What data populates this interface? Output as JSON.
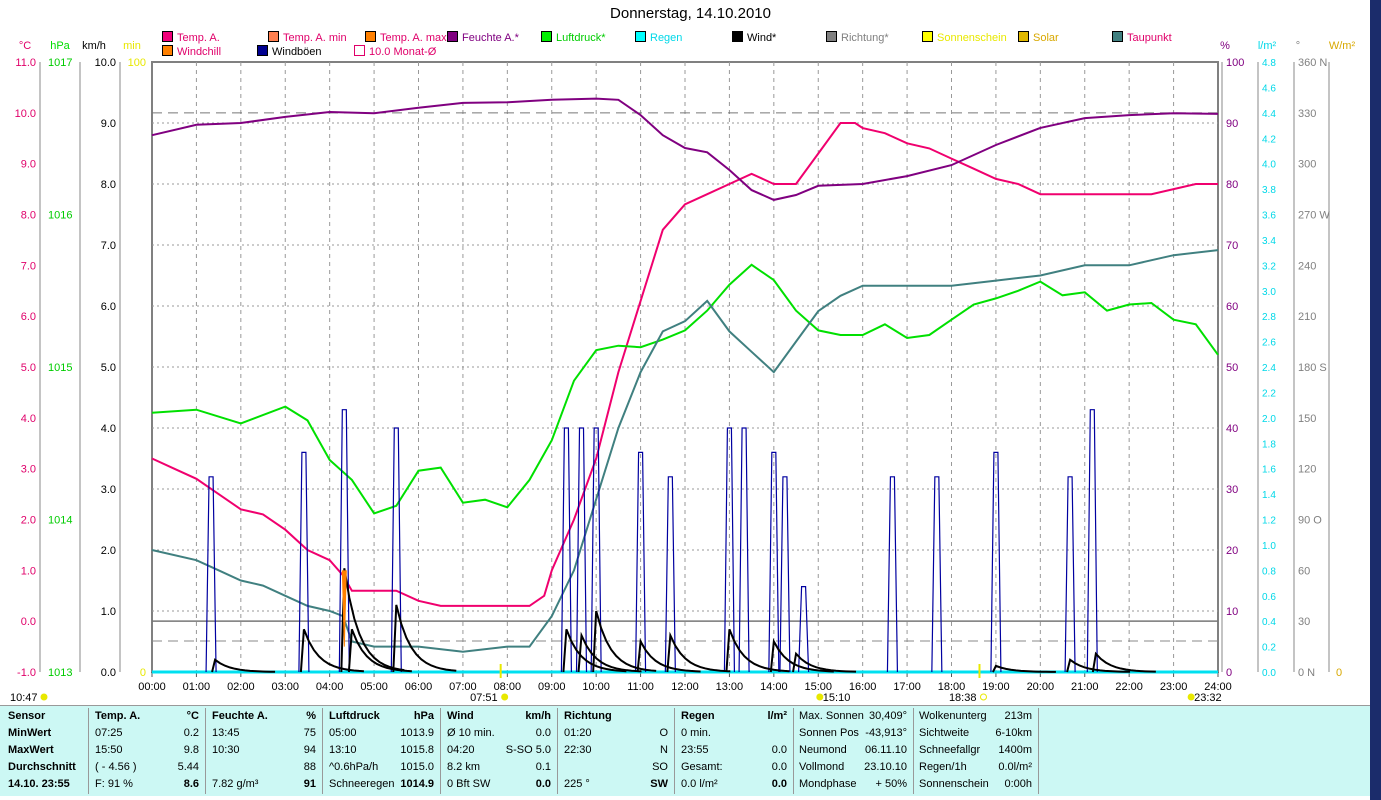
{
  "chart_data": {
    "type": "line",
    "title": "Donnerstag, 14.10.2010",
    "x_axis": {
      "min": 0,
      "max": 24,
      "unit": "hour",
      "tick_labels": [
        "00:00",
        "01:00",
        "02:00",
        "03:00",
        "04:00",
        "05:00",
        "06:00",
        "07:00",
        "08:00",
        "09:00",
        "10:00",
        "11:00",
        "12:00",
        "13:00",
        "14:00",
        "15:00",
        "16:00",
        "17:00",
        "18:00",
        "19:00",
        "20:00",
        "21:00",
        "22:00",
        "23:00",
        "24:00"
      ]
    },
    "axes": {
      "temp": {
        "unit": "°C",
        "min": -1,
        "max": 11,
        "step": 1,
        "color": "#e0006a"
      },
      "pressure": {
        "unit": "hPa",
        "min": 1013,
        "max": 1017,
        "step": 1,
        "color": "#00dd00"
      },
      "wind": {
        "unit": "km/h",
        "min": 0,
        "max": 10,
        "step": 1,
        "color": "#000000"
      },
      "sun": {
        "unit": "min",
        "min": 0,
        "max": 100,
        "color": "#e8e800"
      },
      "humidity": {
        "unit": "%",
        "min": 0,
        "max": 100,
        "step": 10,
        "color": "#800080"
      },
      "rain": {
        "unit": "l/m²",
        "min": 0,
        "max": 4.8,
        "step": 0.2,
        "color": "#00d8e8"
      },
      "direction": {
        "unit": "°",
        "min": 0,
        "max": 360,
        "step": 30,
        "color": "#808080",
        "compass": {
          "0": "N",
          "90": "O",
          "180": "S",
          "270": "W",
          "360": "N"
        }
      },
      "solar": {
        "unit": "W/m²",
        "min": 0,
        "color": "#d8a800"
      }
    },
    "legend": [
      {
        "label": "Temp. A.",
        "color": "#f0007a",
        "text_color": "#e0006a"
      },
      {
        "label": "Temp. A. min",
        "color": "#ff8050",
        "text_color": "#e0006a"
      },
      {
        "label": "Temp. A. max",
        "color": "#ff8000",
        "text_color": "#e0006a"
      },
      {
        "label": "Feuchte A.*",
        "color": "#800080",
        "text_color": "#800080"
      },
      {
        "label": "Luftdruck*",
        "color": "#00ee00",
        "text_color": "#00cc00"
      },
      {
        "label": "Regen",
        "color": "#00ffff",
        "text_color": "#00d8e8"
      },
      {
        "label": "Wind*",
        "color": "#000000",
        "text_color": "#000000"
      },
      {
        "label": "Richtung*",
        "color": "#808080",
        "text_color": "#808080"
      },
      {
        "label": "Sonnenschein",
        "color": "#ffff00",
        "text_color": "#e8e800"
      },
      {
        "label": "Solar",
        "color": "#e0b800",
        "text_color": "#d8a800"
      },
      {
        "label": "Taupunkt",
        "color": "#408080",
        "text_color": "#e0006a"
      },
      {
        "label": "Windchill",
        "color": "#ff8000",
        "text_color": "#e0006a"
      },
      {
        "label": "Windböen",
        "color": "#000090",
        "text_color": "#000000"
      },
      {
        "label": "10.0 Monat-Ø",
        "color": "#ffffff",
        "text_color": "#e0006a"
      }
    ],
    "reference_lines": {
      "monthly_avg_temp": 10.0,
      "freezing_temp": 0.0
    },
    "series": [
      {
        "name": "Temp. A.",
        "axis": "temp",
        "color": "#f0006e",
        "points": [
          [
            0,
            3.2
          ],
          [
            0.5,
            3.0
          ],
          [
            1,
            2.8
          ],
          [
            1.5,
            2.5
          ],
          [
            2,
            2.2
          ],
          [
            2.5,
            2.1
          ],
          [
            3,
            1.8
          ],
          [
            3.5,
            1.4
          ],
          [
            4,
            1.2
          ],
          [
            4.3,
            0.9
          ],
          [
            4.5,
            0.6
          ],
          [
            5,
            0.6
          ],
          [
            5.5,
            0.6
          ],
          [
            6,
            0.4
          ],
          [
            6.5,
            0.3
          ],
          [
            7,
            0.3
          ],
          [
            7.5,
            0.3
          ],
          [
            8,
            0.3
          ],
          [
            8.5,
            0.3
          ],
          [
            8.83,
            0.5
          ],
          [
            9,
            1.0
          ],
          [
            9.5,
            2.0
          ],
          [
            10,
            3.2
          ],
          [
            10.5,
            4.9
          ],
          [
            11,
            6.3
          ],
          [
            11.5,
            7.7
          ],
          [
            12,
            8.2
          ],
          [
            12.5,
            8.4
          ],
          [
            13,
            8.6
          ],
          [
            13.5,
            8.8
          ],
          [
            14,
            8.6
          ],
          [
            14.5,
            8.6
          ],
          [
            15,
            9.2
          ],
          [
            15.5,
            9.8
          ],
          [
            15.83,
            9.8
          ],
          [
            16,
            9.7
          ],
          [
            16.5,
            9.6
          ],
          [
            17,
            9.4
          ],
          [
            17.5,
            9.3
          ],
          [
            18,
            9.1
          ],
          [
            18.5,
            8.9
          ],
          [
            19,
            8.7
          ],
          [
            19.5,
            8.6
          ],
          [
            20,
            8.4
          ],
          [
            20.5,
            8.4
          ],
          [
            21,
            8.4
          ],
          [
            21.5,
            8.4
          ],
          [
            22,
            8.4
          ],
          [
            22.5,
            8.4
          ],
          [
            23,
            8.5
          ],
          [
            23.5,
            8.6
          ],
          [
            24,
            8.6
          ]
        ]
      },
      {
        "name": "Feuchte A.*",
        "axis": "humidity",
        "color": "#800080",
        "points": [
          [
            0,
            88
          ],
          [
            1,
            89.7
          ],
          [
            2,
            90
          ],
          [
            3,
            91
          ],
          [
            4,
            91.8
          ],
          [
            5,
            91.6
          ],
          [
            6,
            92.5
          ],
          [
            7,
            93.3
          ],
          [
            8,
            93.4
          ],
          [
            9,
            93.8
          ],
          [
            10,
            94
          ],
          [
            10.5,
            93.8
          ],
          [
            11,
            91.3
          ],
          [
            11.5,
            88
          ],
          [
            12,
            85.9
          ],
          [
            12.5,
            85.2
          ],
          [
            13,
            82.3
          ],
          [
            13.5,
            79
          ],
          [
            14,
            77.4
          ],
          [
            14.5,
            78.2
          ],
          [
            15,
            79.7
          ],
          [
            16,
            80
          ],
          [
            17,
            81.3
          ],
          [
            18,
            83.1
          ],
          [
            19,
            86.4
          ],
          [
            20,
            89.2
          ],
          [
            21,
            90.8
          ],
          [
            22,
            91.3
          ],
          [
            23,
            91.6
          ],
          [
            24,
            91.5
          ]
        ]
      },
      {
        "name": "Luftdruck*",
        "axis": "pressure",
        "color": "#00e000",
        "points": [
          [
            0,
            1014.7
          ],
          [
            1,
            1014.72
          ],
          [
            2,
            1014.63
          ],
          [
            3,
            1014.74
          ],
          [
            3.5,
            1014.65
          ],
          [
            4,
            1014.39
          ],
          [
            4.5,
            1014.26
          ],
          [
            5,
            1014.04
          ],
          [
            5.5,
            1014.09
          ],
          [
            6,
            1014.32
          ],
          [
            6.5,
            1014.34
          ],
          [
            7,
            1014.11
          ],
          [
            7.5,
            1014.13
          ],
          [
            8,
            1014.08
          ],
          [
            8.5,
            1014.26
          ],
          [
            9,
            1014.52
          ],
          [
            9.5,
            1014.91
          ],
          [
            10,
            1015.11
          ],
          [
            10.5,
            1015.14
          ],
          [
            11,
            1015.13
          ],
          [
            11.5,
            1015.18
          ],
          [
            12,
            1015.24
          ],
          [
            12.5,
            1015.37
          ],
          [
            13,
            1015.54
          ],
          [
            13.5,
            1015.67
          ],
          [
            14,
            1015.57
          ],
          [
            14.5,
            1015.37
          ],
          [
            15,
            1015.24
          ],
          [
            15.5,
            1015.21
          ],
          [
            16,
            1015.21
          ],
          [
            16.5,
            1015.28
          ],
          [
            17,
            1015.19
          ],
          [
            17.5,
            1015.21
          ],
          [
            18,
            1015.31
          ],
          [
            18.5,
            1015.41
          ],
          [
            19,
            1015.45
          ],
          [
            19.5,
            1015.5
          ],
          [
            20,
            1015.56
          ],
          [
            20.5,
            1015.47
          ],
          [
            21,
            1015.49
          ],
          [
            21.5,
            1015.37
          ],
          [
            22,
            1015.41
          ],
          [
            22.5,
            1015.42
          ],
          [
            23,
            1015.31
          ],
          [
            23.5,
            1015.28
          ],
          [
            24,
            1015.08
          ]
        ]
      },
      {
        "name": "Taupunkt",
        "axis": "temp",
        "color": "#408080",
        "points": [
          [
            0,
            1.4
          ],
          [
            1,
            1.2
          ],
          [
            1.5,
            1.0
          ],
          [
            2,
            0.8
          ],
          [
            2.5,
            0.7
          ],
          [
            3,
            0.5
          ],
          [
            3.5,
            0.3
          ],
          [
            4,
            0.2
          ],
          [
            4.3,
            0.1
          ],
          [
            4.5,
            -0.4
          ],
          [
            5,
            -0.5
          ],
          [
            6,
            -0.5
          ],
          [
            7,
            -0.6
          ],
          [
            8,
            -0.5
          ],
          [
            8.5,
            -0.5
          ],
          [
            9,
            0.1
          ],
          [
            9.5,
            1.0
          ],
          [
            10,
            2.4
          ],
          [
            10.5,
            3.8
          ],
          [
            11,
            4.9
          ],
          [
            11.5,
            5.7
          ],
          [
            12,
            5.9
          ],
          [
            12.5,
            6.3
          ],
          [
            13,
            5.7
          ],
          [
            13.5,
            5.3
          ],
          [
            14,
            4.9
          ],
          [
            14.5,
            5.5
          ],
          [
            15,
            6.1
          ],
          [
            15.5,
            6.4
          ],
          [
            16,
            6.6
          ],
          [
            17,
            6.6
          ],
          [
            18,
            6.6
          ],
          [
            19,
            6.7
          ],
          [
            20,
            6.8
          ],
          [
            21,
            7.0
          ],
          [
            22,
            7.0
          ],
          [
            23,
            7.2
          ],
          [
            24,
            7.3
          ]
        ]
      },
      {
        "name": "Wind*",
        "axis": "wind",
        "color": "#000000",
        "peaks": [
          [
            1.42,
            0.2
          ],
          [
            3.42,
            0.7
          ],
          [
            4.33,
            1.7
          ],
          [
            4.5,
            0.7
          ],
          [
            5.5,
            1.1
          ],
          [
            9.33,
            0.7
          ],
          [
            9.67,
            0.6
          ],
          [
            10,
            1.0
          ],
          [
            11,
            0.5
          ],
          [
            11.67,
            0.6
          ],
          [
            13,
            0.7
          ],
          [
            14,
            0.5
          ],
          [
            14.5,
            0.3
          ],
          [
            19,
            0.1
          ],
          [
            20.67,
            0.2
          ],
          [
            21.25,
            0.3
          ]
        ]
      },
      {
        "name": "Windböen",
        "axis": "wind",
        "color": "#0000a0",
        "peaks": [
          [
            1.33,
            3.2
          ],
          [
            3.42,
            3.6
          ],
          [
            4.33,
            4.3
          ],
          [
            5.5,
            4.0
          ],
          [
            9.33,
            4.0
          ],
          [
            9.67,
            4.0
          ],
          [
            10,
            4.0
          ],
          [
            11,
            3.6
          ],
          [
            11.67,
            3.2
          ],
          [
            13,
            4.0
          ],
          [
            13.33,
            4.0
          ],
          [
            14,
            3.6
          ],
          [
            14.25,
            3.2
          ],
          [
            14.67,
            1.4
          ],
          [
            16.67,
            3.2
          ],
          [
            17.67,
            3.2
          ],
          [
            19,
            3.6
          ],
          [
            20.67,
            3.2
          ],
          [
            21.17,
            4.3
          ]
        ]
      },
      {
        "name": "Regen",
        "axis": "rain",
        "color": "#00e0f0",
        "points": [
          [
            0,
            0
          ],
          [
            24,
            0
          ]
        ]
      }
    ],
    "events": [
      {
        "label": "10:47",
        "hour": 0,
        "kind": "moon",
        "side": "left"
      },
      {
        "label": "07:51",
        "hour": 7.85,
        "kind": "sunrise"
      },
      {
        "label": "15:10",
        "hour": 15.17,
        "kind": "moon"
      },
      {
        "label": "18:38",
        "hour": 18.63,
        "kind": "sunset"
      },
      {
        "label": "23:32",
        "hour": 23.53,
        "kind": "moon"
      }
    ]
  },
  "stats": {
    "columns": [
      {
        "header": "Sensor",
        "unit": "",
        "rows": [
          [
            "MinWert",
            ""
          ],
          [
            "MaxWert",
            ""
          ],
          [
            "Durchschnitt",
            ""
          ],
          [
            "14.10. 23:55",
            ""
          ]
        ]
      },
      {
        "header": "Temp. A.",
        "unit": "°C",
        "rows": [
          [
            "07:25",
            "0.2"
          ],
          [
            "15:50",
            "9.8"
          ],
          [
            "( - 4.56 )",
            "5.44"
          ],
          [
            "F: 91 %",
            "8.6"
          ]
        ]
      },
      {
        "header": "Feuchte A.",
        "unit": "%",
        "rows": [
          [
            "13:45",
            "75"
          ],
          [
            "10:30",
            "94"
          ],
          [
            "",
            "88"
          ],
          [
            "7.82 g/m³",
            "91"
          ]
        ]
      },
      {
        "header": "Luftdruck",
        "unit": "hPa",
        "rows": [
          [
            "05:00",
            "1013.9"
          ],
          [
            "13:10",
            "1015.8"
          ],
          [
            "^0.6hPa/h",
            "1015.0"
          ],
          [
            "Schneeregen",
            "1014.9"
          ]
        ]
      },
      {
        "header": "Wind",
        "unit": "km/h",
        "rows": [
          [
            "Ø 10 min.",
            "0.0"
          ],
          [
            "04:20",
            "S-SO 5.0"
          ],
          [
            "8.2 km",
            "0.1"
          ],
          [
            "0 Bft SW",
            "0.0"
          ]
        ]
      },
      {
        "header": "Richtung",
        "unit": "",
        "rows": [
          [
            "01:20",
            "O"
          ],
          [
            "22:30",
            "N"
          ],
          [
            "",
            "SO"
          ],
          [
            "225 °",
            "SW"
          ]
        ]
      },
      {
        "header": "Regen",
        "unit": "l/m²",
        "rows": [
          [
            "0 min.",
            ""
          ],
          [
            "23:55",
            "0.0"
          ],
          [
            "Gesamt:",
            "0.0"
          ],
          [
            "0.0 l/m²",
            "0.0"
          ]
        ]
      }
    ],
    "astro": [
      [
        "Max. Sonnen",
        "30,409°"
      ],
      [
        "Sonnen Pos",
        "-43,913°"
      ],
      [
        "Neumond",
        "06.11.10"
      ],
      [
        "Vollmond",
        "23.10.10"
      ],
      [
        "Mondphase",
        "+ 50%"
      ]
    ],
    "weather": [
      [
        "Wolkenunterg",
        "213m"
      ],
      [
        "Sichtweite",
        "6-10km"
      ],
      [
        "Schneefallgr",
        "1400m"
      ],
      [
        "Regen/1h",
        "0.0l/m²"
      ],
      [
        "Sonnenschein",
        "0:00h"
      ]
    ]
  }
}
